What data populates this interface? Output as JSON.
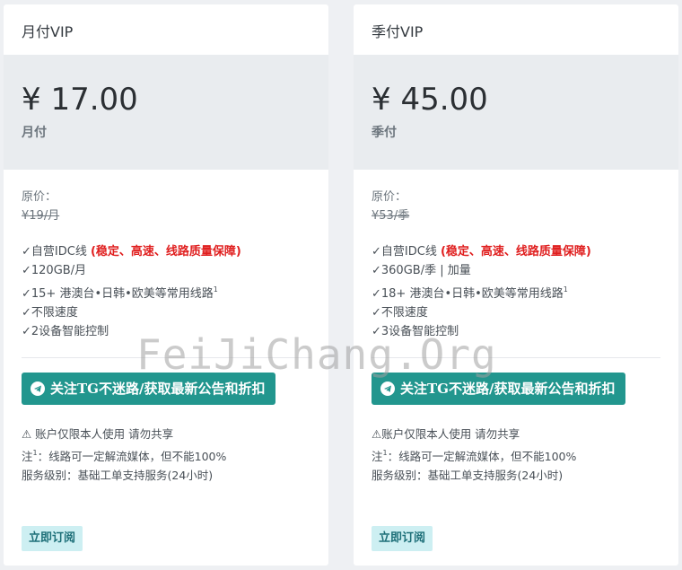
{
  "plans": [
    {
      "header": "月付VIP",
      "price": "¥ 17.00",
      "period": "月付",
      "orig_label": "原价：",
      "orig_price": "¥19/月",
      "feature1_prefix": "✓自营IDC线 ",
      "feature1_highlight": "(稳定、高速、线路质量保障)",
      "feature2": "✓120GB/月",
      "feature3": "✓15+ 港澳台•日韩•欧美等常用线路",
      "feature3_sup": "1",
      "feature4": "✓不限速度",
      "feature5": "✓2设备智能控制",
      "tg_button": "关注TG不迷路/获取最新公告和折扣",
      "note1": "⚠ 账户仅限本人使用 请勿共享",
      "note2_prefix": "注",
      "note2_sup": "1",
      "note2_text": "：线路可一定解流媒体，但不能100%",
      "note3": "服务级别：基础工单支持服务(24小时)",
      "subscribe": "立即订阅"
    },
    {
      "header": "季付VIP",
      "price": "¥ 45.00",
      "period": "季付",
      "orig_label": "原价：",
      "orig_price": "¥53/季",
      "feature1_prefix": "✓自营IDC线 ",
      "feature1_highlight": "(稳定、高速、线路质量保障)",
      "feature2": "✓360GB/季 | 加量",
      "feature3": "✓18+ 港澳台•日韩•欧美等常用线路",
      "feature3_sup": "1",
      "feature4": "✓不限速度",
      "feature5": "✓3设备智能控制",
      "tg_button": "关注TG不迷路/获取最新公告和折扣",
      "note1": "⚠账户仅限本人使用 请勿共享",
      "note2_prefix": "注",
      "note2_sup": "1",
      "note2_text": "：线路可一定解流媒体，但不能100%",
      "note3": "服务级别：基础工单支持服务(24小时)",
      "subscribe": "立即订阅"
    }
  ],
  "watermark": "FeiJiChang.Org",
  "colors": {
    "accent": "#22968e",
    "highlight": "#e02020",
    "price_bg": "#e9ecef",
    "subscribe_bg": "#cdeff2"
  },
  "icons": {
    "tg_button_icon": "telegram-plane-icon"
  }
}
